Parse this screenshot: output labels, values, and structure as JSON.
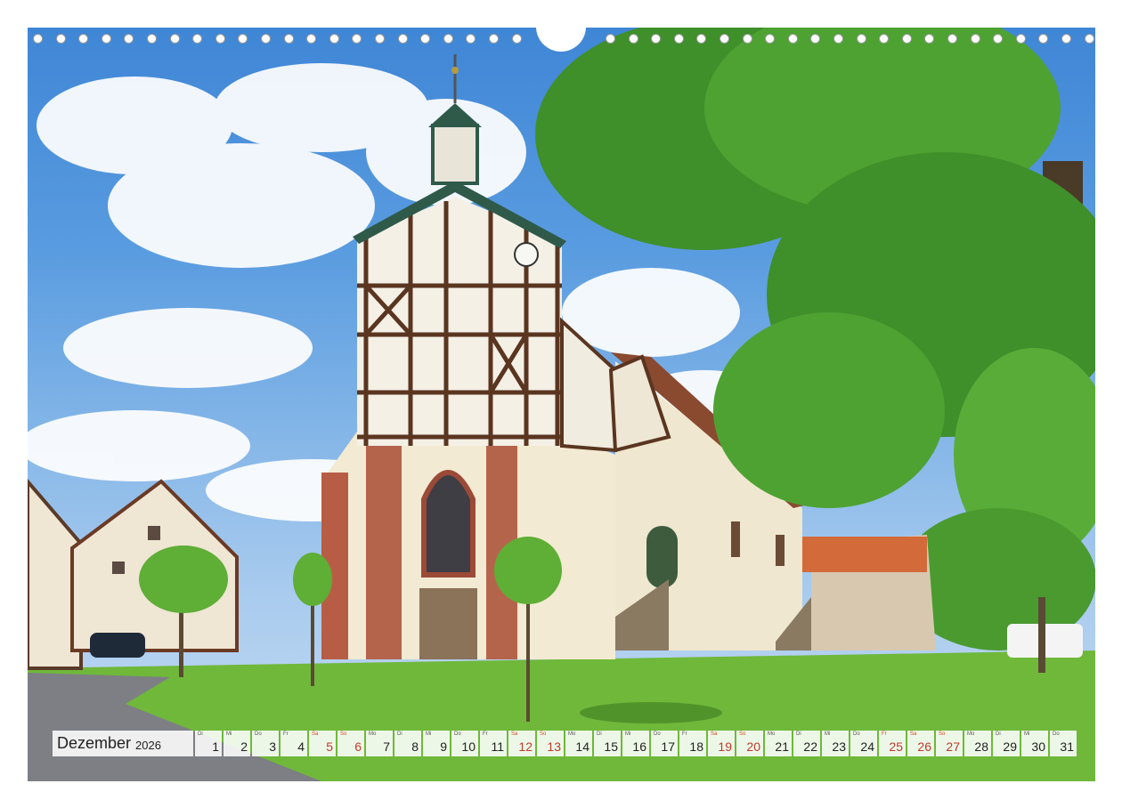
{
  "calendar": {
    "month": "Dezember",
    "year": "2026",
    "days": [
      {
        "dow": "Di",
        "num": "1",
        "weekend": false
      },
      {
        "dow": "Mi",
        "num": "2",
        "weekend": false
      },
      {
        "dow": "Do",
        "num": "3",
        "weekend": false
      },
      {
        "dow": "Fr",
        "num": "4",
        "weekend": false
      },
      {
        "dow": "Sa",
        "num": "5",
        "weekend": true
      },
      {
        "dow": "So",
        "num": "6",
        "weekend": true
      },
      {
        "dow": "Mo",
        "num": "7",
        "weekend": false
      },
      {
        "dow": "Di",
        "num": "8",
        "weekend": false
      },
      {
        "dow": "Mi",
        "num": "9",
        "weekend": false
      },
      {
        "dow": "Do",
        "num": "10",
        "weekend": false
      },
      {
        "dow": "Fr",
        "num": "11",
        "weekend": false
      },
      {
        "dow": "Sa",
        "num": "12",
        "weekend": true
      },
      {
        "dow": "So",
        "num": "13",
        "weekend": true
      },
      {
        "dow": "Mo",
        "num": "14",
        "weekend": false
      },
      {
        "dow": "Di",
        "num": "15",
        "weekend": false
      },
      {
        "dow": "Mi",
        "num": "16",
        "weekend": false
      },
      {
        "dow": "Do",
        "num": "17",
        "weekend": false
      },
      {
        "dow": "Fr",
        "num": "18",
        "weekend": false
      },
      {
        "dow": "Sa",
        "num": "19",
        "weekend": true
      },
      {
        "dow": "So",
        "num": "20",
        "weekend": true
      },
      {
        "dow": "Mo",
        "num": "21",
        "weekend": false
      },
      {
        "dow": "Di",
        "num": "22",
        "weekend": false
      },
      {
        "dow": "Mi",
        "num": "23",
        "weekend": false
      },
      {
        "dow": "Do",
        "num": "24",
        "weekend": false
      },
      {
        "dow": "Fr",
        "num": "25",
        "weekend": true
      },
      {
        "dow": "Sa",
        "num": "26",
        "weekend": true
      },
      {
        "dow": "So",
        "num": "27",
        "weekend": true
      },
      {
        "dow": "Mo",
        "num": "28",
        "weekend": false
      },
      {
        "dow": "Di",
        "num": "29",
        "weekend": false
      },
      {
        "dow": "Mi",
        "num": "30",
        "weekend": false
      },
      {
        "dow": "Do",
        "num": "31",
        "weekend": false
      }
    ]
  },
  "colors": {
    "weekend": "#c0392b",
    "sky": "#4a8fd8",
    "foliage": "#3f8f2a",
    "lawn": "#6fb83a"
  },
  "photo": {
    "subject": "half-timbered church with octagonal tower"
  }
}
